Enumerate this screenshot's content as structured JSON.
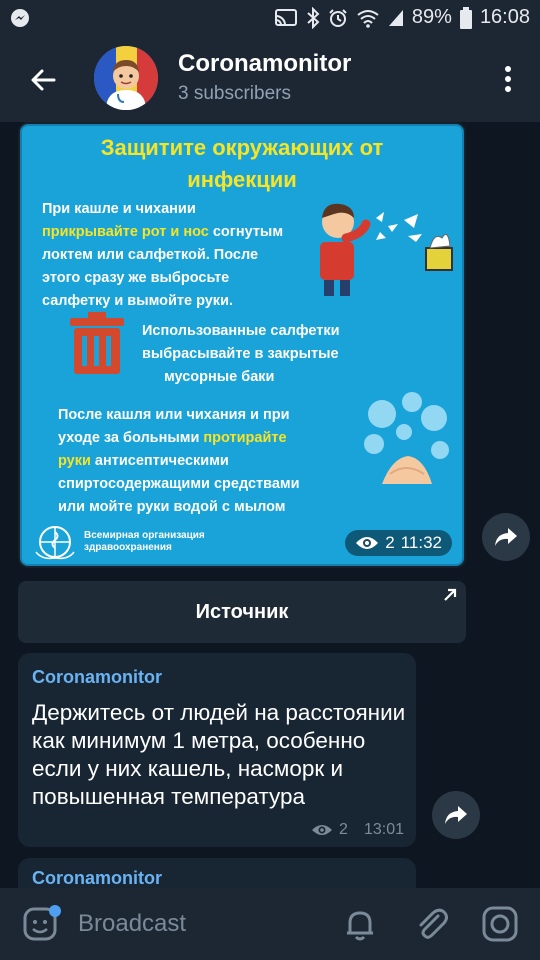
{
  "status_bar": {
    "battery": "89%",
    "time": "16:08",
    "icons": [
      "messenger-icon",
      "cast-icon",
      "bluetooth-icon",
      "alarm-icon",
      "wifi-icon",
      "signal-icon",
      "battery-icon"
    ]
  },
  "header": {
    "title": "Coronamonitor",
    "subtitle": "3 subscribers"
  },
  "post_image": {
    "title_line1": "Защитите окружающих от",
    "title_line2": "инфекции",
    "para1_a": "При кашле и чихании",
    "para1_hl": "прикрывайте рот и нос",
    "para1_b": " согнутым",
    "para1_line3": "локтем или салфеткой. После",
    "para1_line4": "этого сразу же выбросьте",
    "para1_line5": "салфетку и вымойте руки.",
    "para2_line1": "Использованные салфетки",
    "para2_line2": "выбрасывайте в закрытые",
    "para2_line3": "мусорные баки",
    "para3_line1": "После кашля или чихания и при",
    "para3_a": "уходе за больными ",
    "para3_hl1": "протирайте",
    "para3_hl2": "руки",
    "para3_b": " антисептическими",
    "para3_line4": "спиртосодержащими средствами",
    "para3_line5": "или мойте руки водой с мылом",
    "who_line1": "Всемирная организация",
    "who_line2": "здравоохранения",
    "views": "2",
    "time": "11:32"
  },
  "source_button": {
    "label": "Источник"
  },
  "messages": [
    {
      "author": "Coronamonitor",
      "text": "Держитесь от людей на расстоянии как минимум 1 метра, особенно если у них кашель, насморк и повышенная температура",
      "views": "2",
      "time": "13:01"
    },
    {
      "author": "Coronamonitor"
    }
  ],
  "composer": {
    "placeholder": "Broadcast"
  },
  "colors": {
    "background": "#0e1621",
    "header": "#1d2733",
    "bubble": "#182533",
    "author": "#6ab3f3",
    "poster": "#1aa3d9",
    "poster_highlight": "#f6e427"
  }
}
